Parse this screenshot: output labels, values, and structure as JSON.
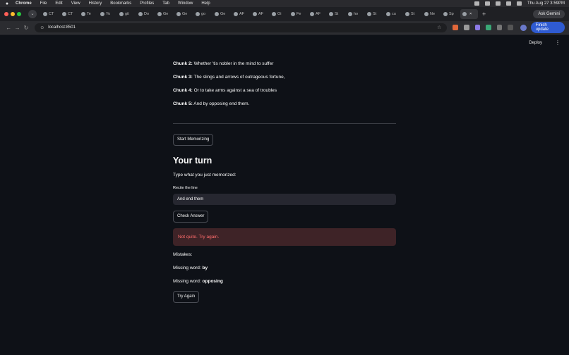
{
  "menubar": {
    "app": "Chrome",
    "items": [
      "File",
      "Edit",
      "View",
      "History",
      "Bookmarks",
      "Profiles",
      "Tab",
      "Window",
      "Help"
    ],
    "clock": "Thu Aug 27  3:59PM"
  },
  "tabs": [
    "CT",
    "CT",
    "Te",
    "Yo",
    "git",
    "Do",
    "Ge",
    "Ge",
    "go",
    "Ge",
    "AF",
    "AF",
    "Oi",
    "Fe",
    "AF",
    "St",
    "ho",
    "St",
    "cu",
    "St",
    "Ne",
    "Sp",
    ""
  ],
  "ask_gemini": "Ask Gemini",
  "url": "localhost:8501",
  "finish_update": "Finish update",
  "deploy": "Deploy",
  "chunks": [
    {
      "label": "Chunk 2:",
      "text": " Whether 'tis nobler in the mind to suffer"
    },
    {
      "label": "Chunk 3:",
      "text": " The slings and arrows of outrageous fortune,"
    },
    {
      "label": "Chunk 4:",
      "text": " Or to take arms against a sea of troubles"
    },
    {
      "label": "Chunk 5:",
      "text": " And by opposing end them."
    }
  ],
  "start_button": "Start Memorizing",
  "heading": "Your turn",
  "instruction": "Type what you just memorized:",
  "input_label": "Recite the line",
  "input_value": "And end them",
  "check_button": "Check Answer",
  "error_message": "Not quite. Try again.",
  "mistakes_label": "Mistakes:",
  "mistakes": [
    {
      "prefix": "Missing word: ",
      "word": "by"
    },
    {
      "prefix": "Missing word: ",
      "word": "opposing"
    }
  ],
  "retry_button": "Try Again",
  "colors": {
    "background": "#0e1117",
    "input": "#262730",
    "error_bg": "#3e2327",
    "error_text": "#ff6c6c",
    "accent": "#2f5bd1"
  }
}
